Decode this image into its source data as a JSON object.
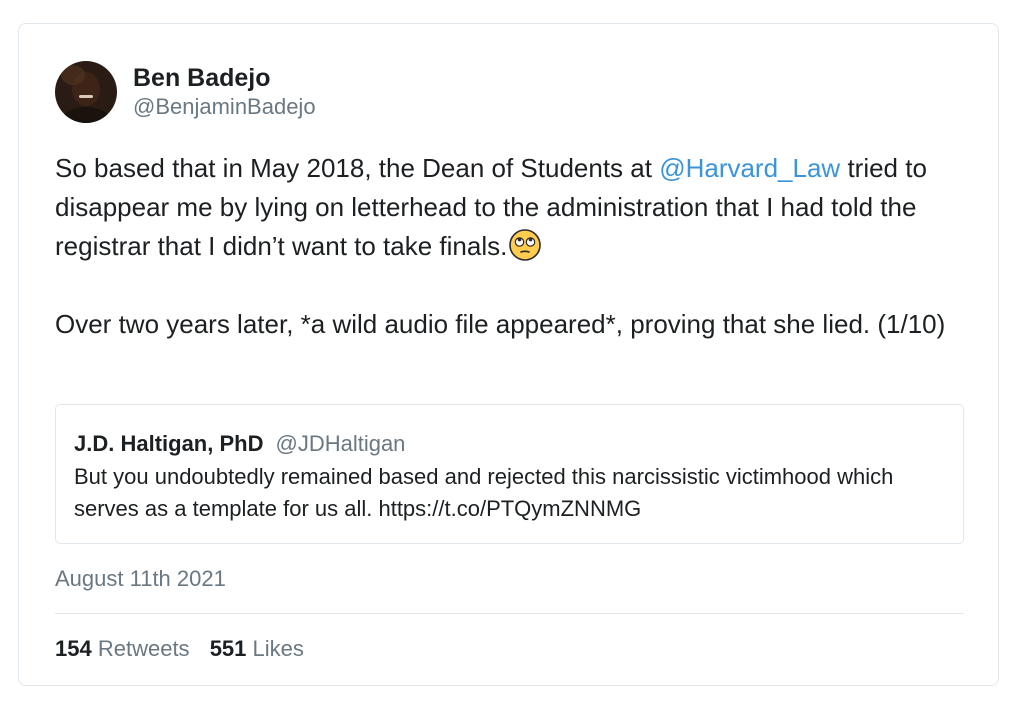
{
  "tweet": {
    "display_name": "Ben Badejo",
    "handle": "@BenjaminBadejo",
    "text_line1_pre": "So based that in May 2018, the Dean of Students at ",
    "mention": "@Harvard_Law",
    "text_line1_post": " tried to disappear me by lying on letterhead to the administration that I had told the registrar that I didn’t want to take finals.",
    "emoji_icon": "face-with-rolling-eyes-icon",
    "text_para2": "Over two years later, *a wild audio file appeared*, proving that she lied. (1/10)",
    "date": "August 11th 2021"
  },
  "quote": {
    "name": "J.D. Haltigan, PhD",
    "handle": "@JDHaltigan",
    "text": "But you undoubtedly remained based and rejected this narcissistic victimhood which serves as a template for us all. https://t.co/PTQymZNNMG"
  },
  "stats": {
    "retweets_count": "154",
    "retweets_label": "Retweets",
    "likes_count": "551",
    "likes_label": "Likes"
  },
  "colors": {
    "link": "#3b94d9",
    "text": "#1c2022",
    "muted": "#697882",
    "border": "#e1e8ed"
  }
}
